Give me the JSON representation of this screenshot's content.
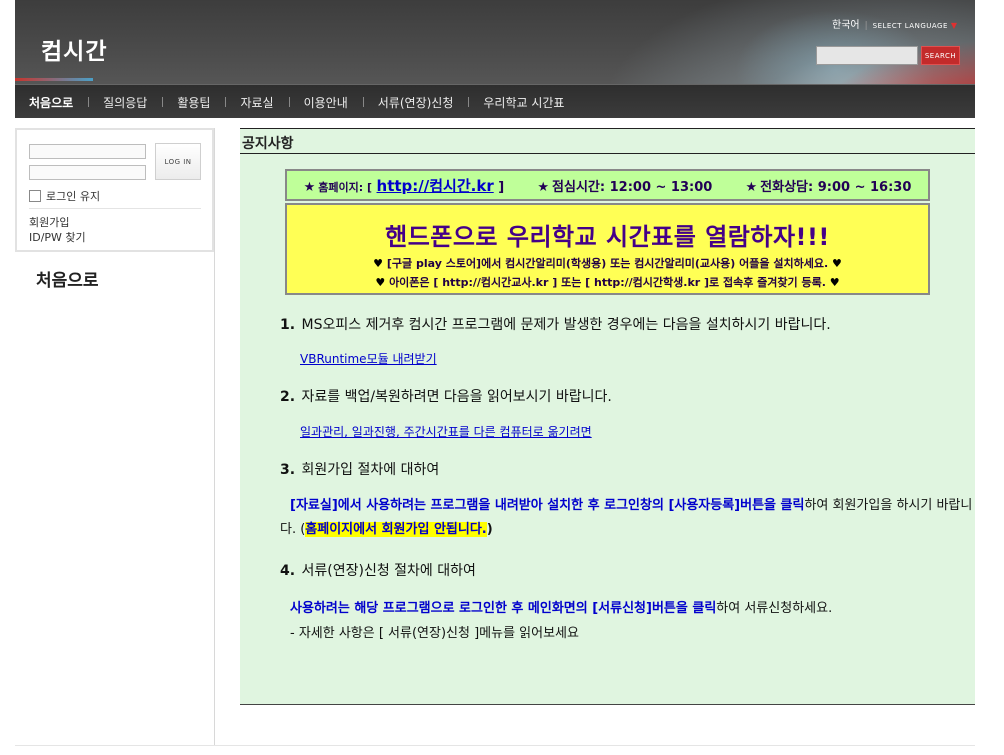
{
  "header": {
    "site_title": "컴시간",
    "language": "한국어",
    "select_language": "SELECT LANGUAGE",
    "search_button": "SEARCH",
    "search_placeholder": ""
  },
  "nav": {
    "items": [
      "처음으로",
      "질의응답",
      "활용팁",
      "자료실",
      "이용안내",
      "서류(연장)신청",
      "우리학교 시간표"
    ]
  },
  "login": {
    "button": "LOG IN",
    "keep_login": "로그인 유지",
    "join": "회원가입",
    "find": "ID/PW 찾기"
  },
  "sidebar": {
    "heading": "처음으로"
  },
  "content": {
    "title": "공지사항",
    "info_bar": {
      "homepage_label": "홈페이지: [",
      "homepage_link": "http://컴시간.kr",
      "homepage_close": "]",
      "lunch": "점심시간: 12:00 ~ 13:00",
      "phone": "전화상담: 9:00 ~ 16:30"
    },
    "banner": {
      "headline": "핸드폰으로 우리학교 시간표를 열람하자!!!",
      "line1": "[구글 play 스토어]에서 컴시간알리미(학생용) 또는 컴시간알리미(교사용) 어플을 설치하세요.",
      "line2": "아이폰은 [ http://컴시간교사.kr ] 또는 [ http://컴시간학생.kr ]로 접속후 즐겨찾기 등록."
    },
    "items": [
      {
        "num": "1.",
        "text": "MS오피스 제거후 컴시간 프로그램에 문제가 발생한 경우에는 다음을 설치하시기 바랍니다.",
        "link": "VBRuntime모듈 내려받기"
      },
      {
        "num": "2.",
        "text": "자료를 백업/복원하려면 다음을 읽어보시기 바랍니다.",
        "link": "일과관리, 일과진행, 주간시간표를 다른 컴퓨터로 옮기려면"
      },
      {
        "num": "3.",
        "text": "회원가입 절차에 대하여"
      },
      {
        "num": "4.",
        "text": "서류(연장)신청 절차에 대하여"
      }
    ],
    "para3": {
      "a": "[자료실]에서 사용하려는 프로그램을 내려받아 설치한 후 로그인창의 [사용자등록]버튼을 클릭",
      "b": "하여 회원가입을 하시기 바랍니다. (",
      "c": "홈페이지에서 회원가입 안됩니다.",
      "d": ")"
    },
    "para4": {
      "a": "사용하려는 해당 프로그램으로 로그인한 후 메인화면의 [서류신청]버튼을 클릭",
      "b": "하여 서류신청하세요.",
      "c": "- 자세한 사항은 [ 서류(연장)신청 ]메뉴를 읽어보세요"
    }
  }
}
